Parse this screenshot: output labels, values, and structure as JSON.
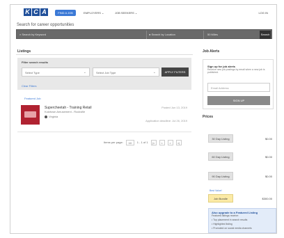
{
  "nav": {
    "logo_letters": [
      "K",
      "C",
      "A"
    ],
    "active_label": "FIND A JOB",
    "links": [
      "EMPLOYERS",
      "JOB SEEKERS"
    ],
    "right_label": "LOG IN"
  },
  "search": {
    "title": "Search for career opportunities",
    "keyword_placeholder": "Search by Keyword",
    "location_placeholder": "Search by Location",
    "distance": "50 Miles",
    "button": "Search"
  },
  "listings": {
    "header": "Listings",
    "filter_title": "Filter search results",
    "select_1": "Select Type",
    "select_2": "Select Job Type",
    "apply_button": "APPLY FILTERS",
    "clear_link": "Clear Filters",
    "meta_link": "Featured Job",
    "job": {
      "title": "Supercheetah - Training Retail",
      "company": "Kutztown Amusement - Rockville",
      "location": "Virginia",
      "date": "Posted Jun 13, 2019",
      "posted": "Application deadline: Jul 26, 2019"
    },
    "pager": {
      "per_page_label": "Items per page:",
      "per_page": "10",
      "range": "1 - 1 of 1",
      "first": "|<",
      "prev": "<",
      "next": ">",
      "last": ">|"
    }
  },
  "alerts": {
    "header": "Job Alerts",
    "title": "Sign up for job alerts",
    "text": "Receive new job postings by email when a new job is published.",
    "email_placeholder": "Email Address",
    "button": "SIGN UP"
  },
  "prices": {
    "header": "Prices",
    "rows": [
      {
        "label": "30 Day Listing",
        "value": "$0.00"
      },
      {
        "label": "60 Day Listing",
        "value": "$0.00"
      },
      {
        "label": "90 Day Listing",
        "value": "$0.00"
      },
      {
        "label": "Job Bundle",
        "value": "$300.00"
      }
    ],
    "highlight_label": "Best Value!",
    "upgrade": {
      "title": "Also upgrade to a Featured Listing",
      "subtitle": "Featured listings receive:",
      "items": [
        "Top placement in search results",
        "Highlighted listing",
        "Promoted on social media channels"
      ]
    }
  }
}
